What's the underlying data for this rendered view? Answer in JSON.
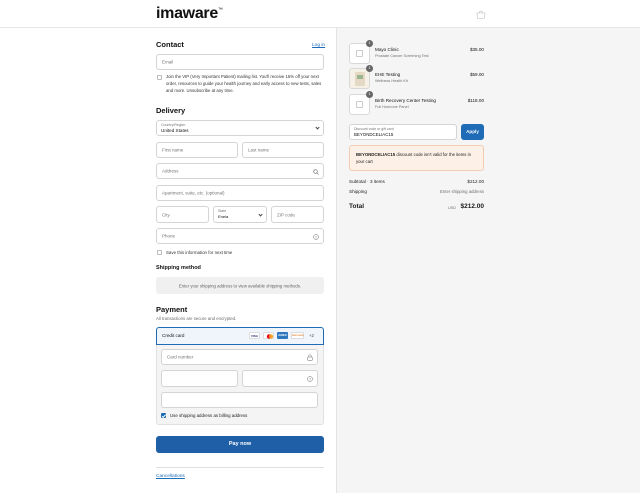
{
  "header": {
    "logo": "imaware",
    "logo_tm": "™",
    "cart_icon": "bag-icon"
  },
  "contact": {
    "title": "Contact",
    "login_link": "Log in",
    "email_placeholder": "Email",
    "vip_text": "Join the VIP (Very Important Patient) mailing list. You'll receive 15% off your next order, resources to guide your health journey and early access to new tests, sales and more. Unsubscribe at any time.",
    "vip_checked": false
  },
  "delivery": {
    "title": "Delivery",
    "country_label": "Country/Region",
    "country_value": "United States",
    "first_name_placeholder": "First name",
    "last_name_placeholder": "Last name",
    "address_placeholder": "Address",
    "apartment_placeholder": "Apartment, suite, etc. (optional)",
    "city_placeholder": "City",
    "state_label": "State",
    "state_value": "Enela",
    "zip_placeholder": "ZIP code",
    "phone_placeholder": "Phone",
    "save_info_label": "Save this information for next time",
    "save_info_checked": false
  },
  "shipping_method": {
    "title": "Shipping method",
    "message": "Enter your shipping address to view available shipping methods."
  },
  "payment": {
    "title": "Payment",
    "subtitle": "All transactions are secure and encrypted.",
    "credit_card_label": "Credit card",
    "brands": [
      "VISA",
      "MC",
      "AMEX",
      "DISCOVER"
    ],
    "more_brands": "+2",
    "card_number_placeholder": "Card number",
    "billing_same_label": "Use shipping address as billing address",
    "billing_same_checked": true,
    "pay_button": "Pay now"
  },
  "footer": {
    "cancellations_link": "Cancellations"
  },
  "order": {
    "items": [
      {
        "name": "Mayo Clinic",
        "sub": "Prostate Cancer Screening Test",
        "price": "$35.00",
        "qty": "1"
      },
      {
        "name": "EHE Testing",
        "sub": "Wellness Health Kit",
        "price": "$59.00",
        "qty": "1"
      },
      {
        "name": "Birth Recovery Center Testing",
        "sub": "Full Hormone Panel",
        "price": "$118.00",
        "qty": "1"
      }
    ],
    "discount_label": "Discount code or gift card",
    "discount_value": "BEYONDCELIAC15",
    "apply_button": "Apply",
    "error_code": "BEYONDCELIAC15",
    "error_text": " discount code isn't valid for the items in your cart",
    "subtotal_label": "Subtotal · 3 items",
    "subtotal_value": "$212.00",
    "shipping_label": "Shipping",
    "shipping_value": "Enter shipping address",
    "total_label": "Total",
    "currency": "USD",
    "total_value": "$212.00"
  },
  "colors": {
    "accent": "#1f6bb5",
    "pay_button": "#1f5fa8",
    "error_bg": "#fdf0e6"
  }
}
